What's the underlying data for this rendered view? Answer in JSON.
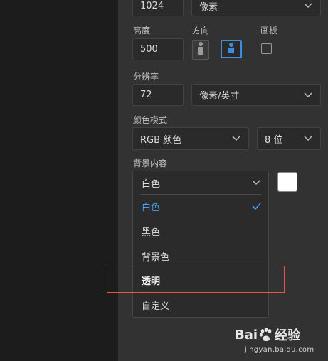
{
  "width": {
    "value": "1024",
    "unit": "像素"
  },
  "height": {
    "label": "高度",
    "value": "500"
  },
  "orientation": {
    "label": "方向",
    "options": [
      "portrait-icon",
      "landscape-icon"
    ],
    "selected": "landscape"
  },
  "artboard": {
    "label": "画板",
    "checked": false
  },
  "resolution": {
    "label": "分辨率",
    "value": "72",
    "unit": "像素/英寸"
  },
  "color_mode": {
    "label": "颜色模式",
    "mode": "RGB 颜色",
    "depth": "8 位"
  },
  "background": {
    "label": "背景内容",
    "selected": "白色",
    "swatch_color": "#ffffff",
    "options": [
      "白色",
      "黑色",
      "背景色",
      "透明",
      "自定义"
    ]
  },
  "accent_color": "#3d8ee0",
  "highlight_color": "#e2574c",
  "watermark": {
    "brand_left": "Bai",
    "brand_right": "经验",
    "url": "jingyan.baidu.com"
  }
}
